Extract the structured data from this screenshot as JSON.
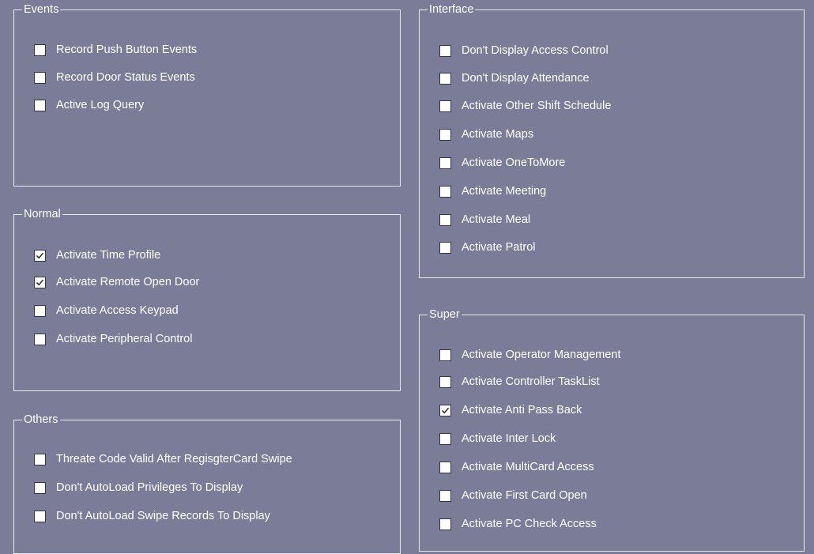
{
  "groups": {
    "events": {
      "title": "Events",
      "items": [
        {
          "label": "Record Push Button Events",
          "checked": false
        },
        {
          "label": "Record Door Status Events",
          "checked": false
        },
        {
          "label": "Active Log Query",
          "checked": false
        }
      ]
    },
    "normal": {
      "title": "Normal",
      "items": [
        {
          "label": "Activate Time Profile",
          "checked": true
        },
        {
          "label": "Activate Remote Open Door",
          "checked": true
        },
        {
          "label": "Activate Access Keypad",
          "checked": false
        },
        {
          "label": "Activate Peripheral Control",
          "checked": false
        }
      ]
    },
    "others": {
      "title": "Others",
      "items": [
        {
          "label": "Threate Code Valid After RegisgterCard Swipe",
          "checked": false
        },
        {
          "label": "Don't AutoLoad Privileges To Display",
          "checked": false
        },
        {
          "label": "Don't AutoLoad Swipe Records To Display",
          "checked": false
        }
      ]
    },
    "interface": {
      "title": "Interface",
      "items": [
        {
          "label": "Don't Display Access Control",
          "checked": false
        },
        {
          "label": "Don't Display Attendance",
          "checked": false
        },
        {
          "label": "Activate Other Shift Schedule",
          "checked": false
        },
        {
          "label": "Activate Maps",
          "checked": false
        },
        {
          "label": "Activate OneToMore",
          "checked": false
        },
        {
          "label": "Activate Meeting",
          "checked": false
        },
        {
          "label": "Activate Meal",
          "checked": false
        },
        {
          "label": "Activate Patrol",
          "checked": false
        }
      ]
    },
    "super": {
      "title": "Super",
      "items": [
        {
          "label": "Activate Operator Management",
          "checked": false
        },
        {
          "label": "Activate Controller TaskList",
          "checked": false
        },
        {
          "label": "Activate Anti Pass Back",
          "checked": true
        },
        {
          "label": "Activate Inter Lock",
          "checked": false
        },
        {
          "label": "Activate MultiCard Access",
          "checked": false
        },
        {
          "label": "Activate First Card Open",
          "checked": false
        },
        {
          "label": "Activate PC Check Access",
          "checked": false
        }
      ]
    }
  }
}
